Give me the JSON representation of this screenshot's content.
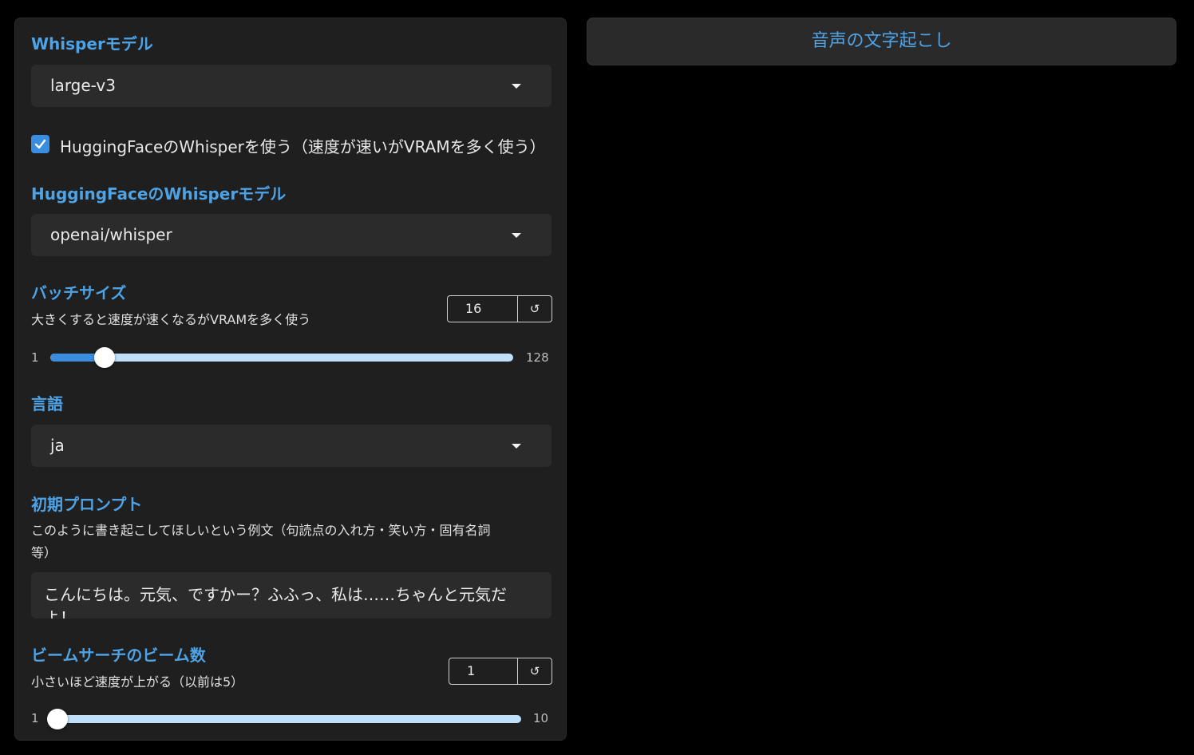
{
  "left_panel": {
    "whisper_model": {
      "label": "Whisperモデル",
      "value": "large-v3"
    },
    "use_hf": {
      "label": "HuggingFaceのWhisperを使う（速度が速いがVRAMを多く使う）",
      "checked": true
    },
    "hf_model": {
      "label": "HuggingFaceのWhisperモデル",
      "value": "openai/whisper"
    },
    "batch_size": {
      "label": "バッチサイズ",
      "info": "大きくすると速度が速くなるがVRAMを多く使う",
      "value": "16",
      "min": "1",
      "max": "128",
      "fraction": 0.118
    },
    "language": {
      "label": "言語",
      "value": "ja"
    },
    "initial_prompt": {
      "label": "初期プロンプト",
      "info_line1": "このように書き起こしてほしいという例文（句読点の入れ方・笑い方・固有名詞",
      "info_line2": "等）",
      "value": "こんにちは。元気、ですかー？ふふっ、私は……ちゃんと元気だよ！"
    },
    "beam_size": {
      "label": "ビームサーチのビーム数",
      "info": "小さいほど速度が上がる（以前は5）",
      "value": "1",
      "min": "1",
      "max": "10",
      "fraction": 0.0
    },
    "reset_icon": "↺"
  },
  "transcribe_button": {
    "label": "音声の文字起こし"
  },
  "colors": {
    "accent": "#4ea3e6",
    "checkbox": "#3a8ee0",
    "panel": "#1f1f1f",
    "background": "#000000"
  }
}
